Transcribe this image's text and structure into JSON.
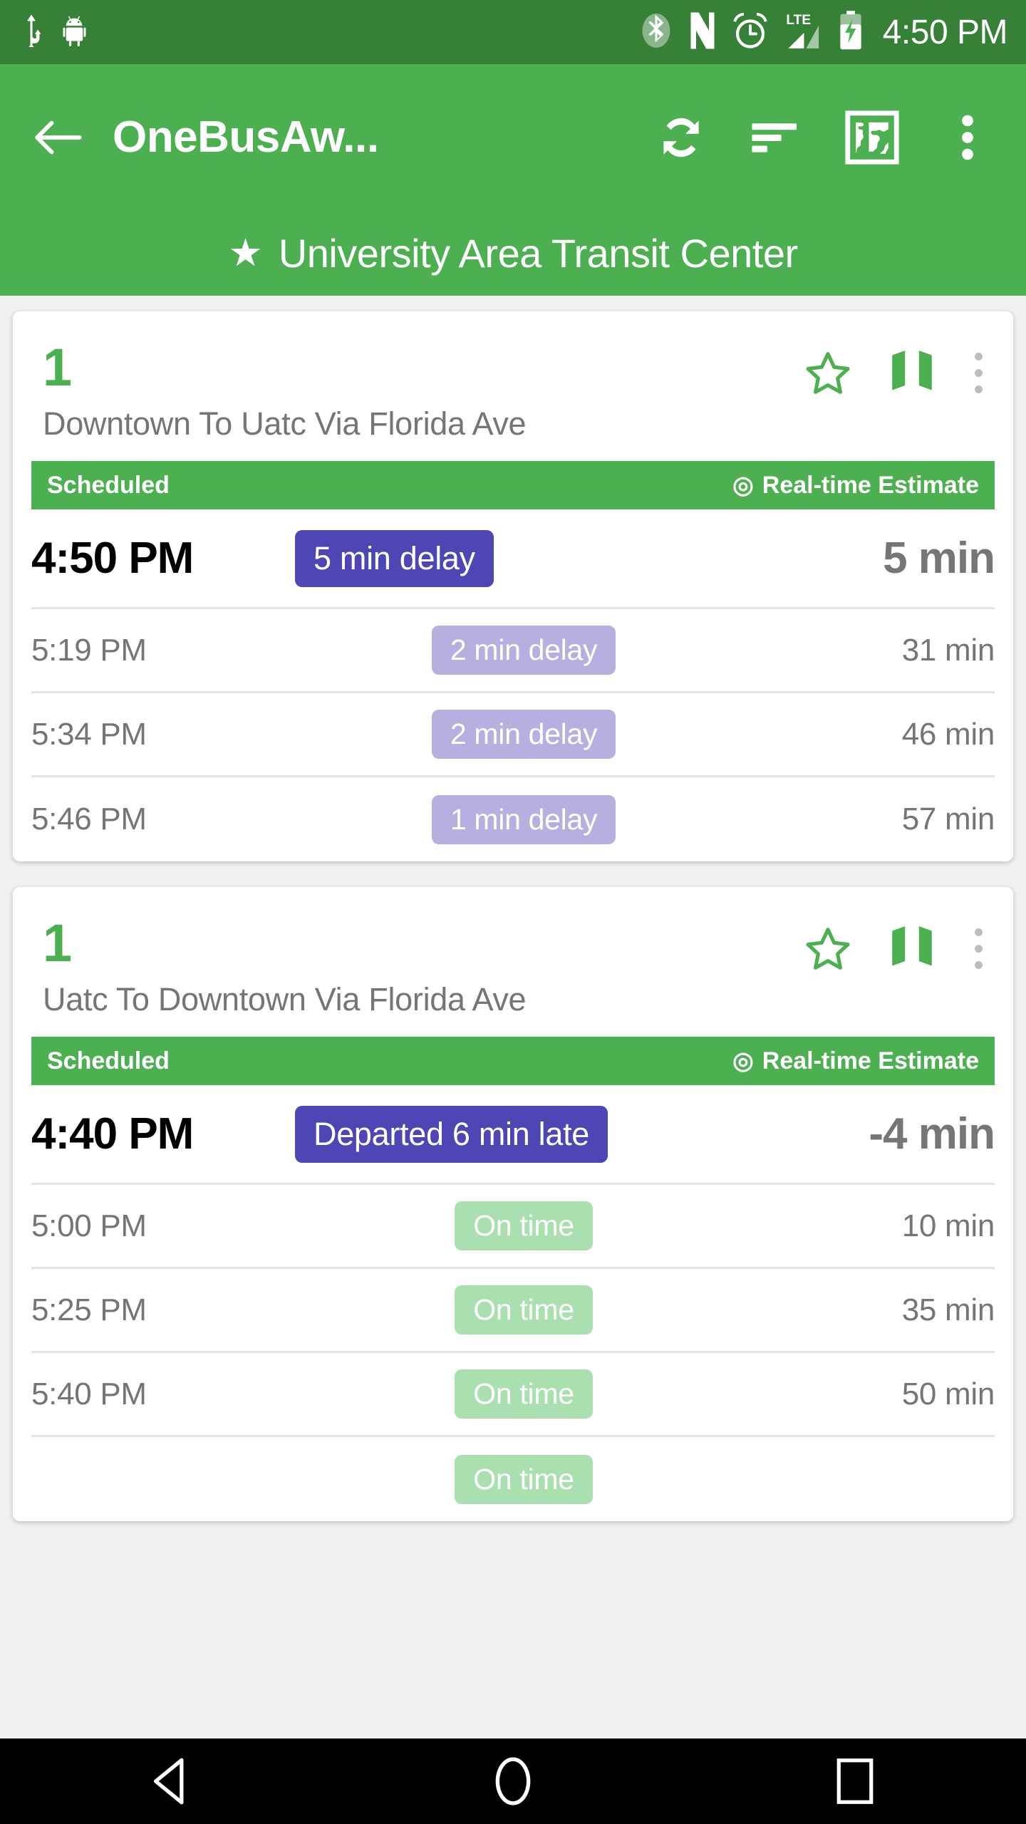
{
  "status_bar": {
    "time": "4:50 PM",
    "icons": [
      "usb-icon",
      "android-debug-icon",
      "bluetooth-icon",
      "nfc-icon",
      "alarm-icon",
      "lte-signal-icon",
      "battery-charging-icon"
    ],
    "background_color": "#368038"
  },
  "app_bar": {
    "back_label": "back-arrow",
    "title": "OneBusAw...",
    "actions": [
      "refresh-icon",
      "sort-icon",
      "map-globe-icon",
      "overflow-menu-icon"
    ],
    "background_color": "#4caf50"
  },
  "stop_header": {
    "star": "★",
    "name": "University Area Transit Center"
  },
  "column_headers": {
    "scheduled": "Scheduled",
    "realtime": "Real-time Estimate",
    "realtime_icon": "◎"
  },
  "colors": {
    "brand_green": "#4caf50",
    "delay_strong": "#4f46b5",
    "delay_soft": "#b6b0e0",
    "ontime_soft": "#aadfb0",
    "muted_text": "#757575"
  },
  "cards": [
    {
      "route_number": "1",
      "destination": "Downtown To Uatc Via Florida Ave",
      "star_icon": "star-outline-icon",
      "map_icon": "route-map-icon",
      "overflow_icon": "overflow-menu-icon",
      "arrivals": [
        {
          "time": "4:50 PM",
          "status": "5 min delay",
          "status_type": "delay-strong",
          "eta": "5 min",
          "primary": true
        },
        {
          "time": "5:19 PM",
          "status": "2 min delay",
          "status_type": "delay-soft",
          "eta": "31 min",
          "primary": false
        },
        {
          "time": "5:34 PM",
          "status": "2 min delay",
          "status_type": "delay-soft",
          "eta": "46 min",
          "primary": false
        },
        {
          "time": "5:46 PM",
          "status": "1 min delay",
          "status_type": "delay-soft",
          "eta": "57 min",
          "primary": false
        }
      ]
    },
    {
      "route_number": "1",
      "destination": "Uatc To Downtown Via Florida Ave",
      "star_icon": "star-outline-icon",
      "map_icon": "route-map-icon",
      "overflow_icon": "overflow-menu-icon",
      "arrivals": [
        {
          "time": "4:40 PM",
          "status": "Departed 6 min late",
          "status_type": "delay-strong",
          "eta": "-4 min",
          "primary": true
        },
        {
          "time": "5:00 PM",
          "status": "On time",
          "status_type": "ontime-soft",
          "eta": "10 min",
          "primary": false
        },
        {
          "time": "5:25 PM",
          "status": "On time",
          "status_type": "ontime-soft",
          "eta": "35 min",
          "primary": false
        },
        {
          "time": "5:40 PM",
          "status": "On time",
          "status_type": "ontime-soft",
          "eta": "50 min",
          "primary": false
        },
        {
          "time": "",
          "status": "On time",
          "status_type": "ontime-soft",
          "eta": "",
          "primary": false
        }
      ]
    }
  ],
  "nav_bar": {
    "back": "nav-back-icon",
    "home": "nav-home-icon",
    "recents": "nav-recents-icon"
  }
}
